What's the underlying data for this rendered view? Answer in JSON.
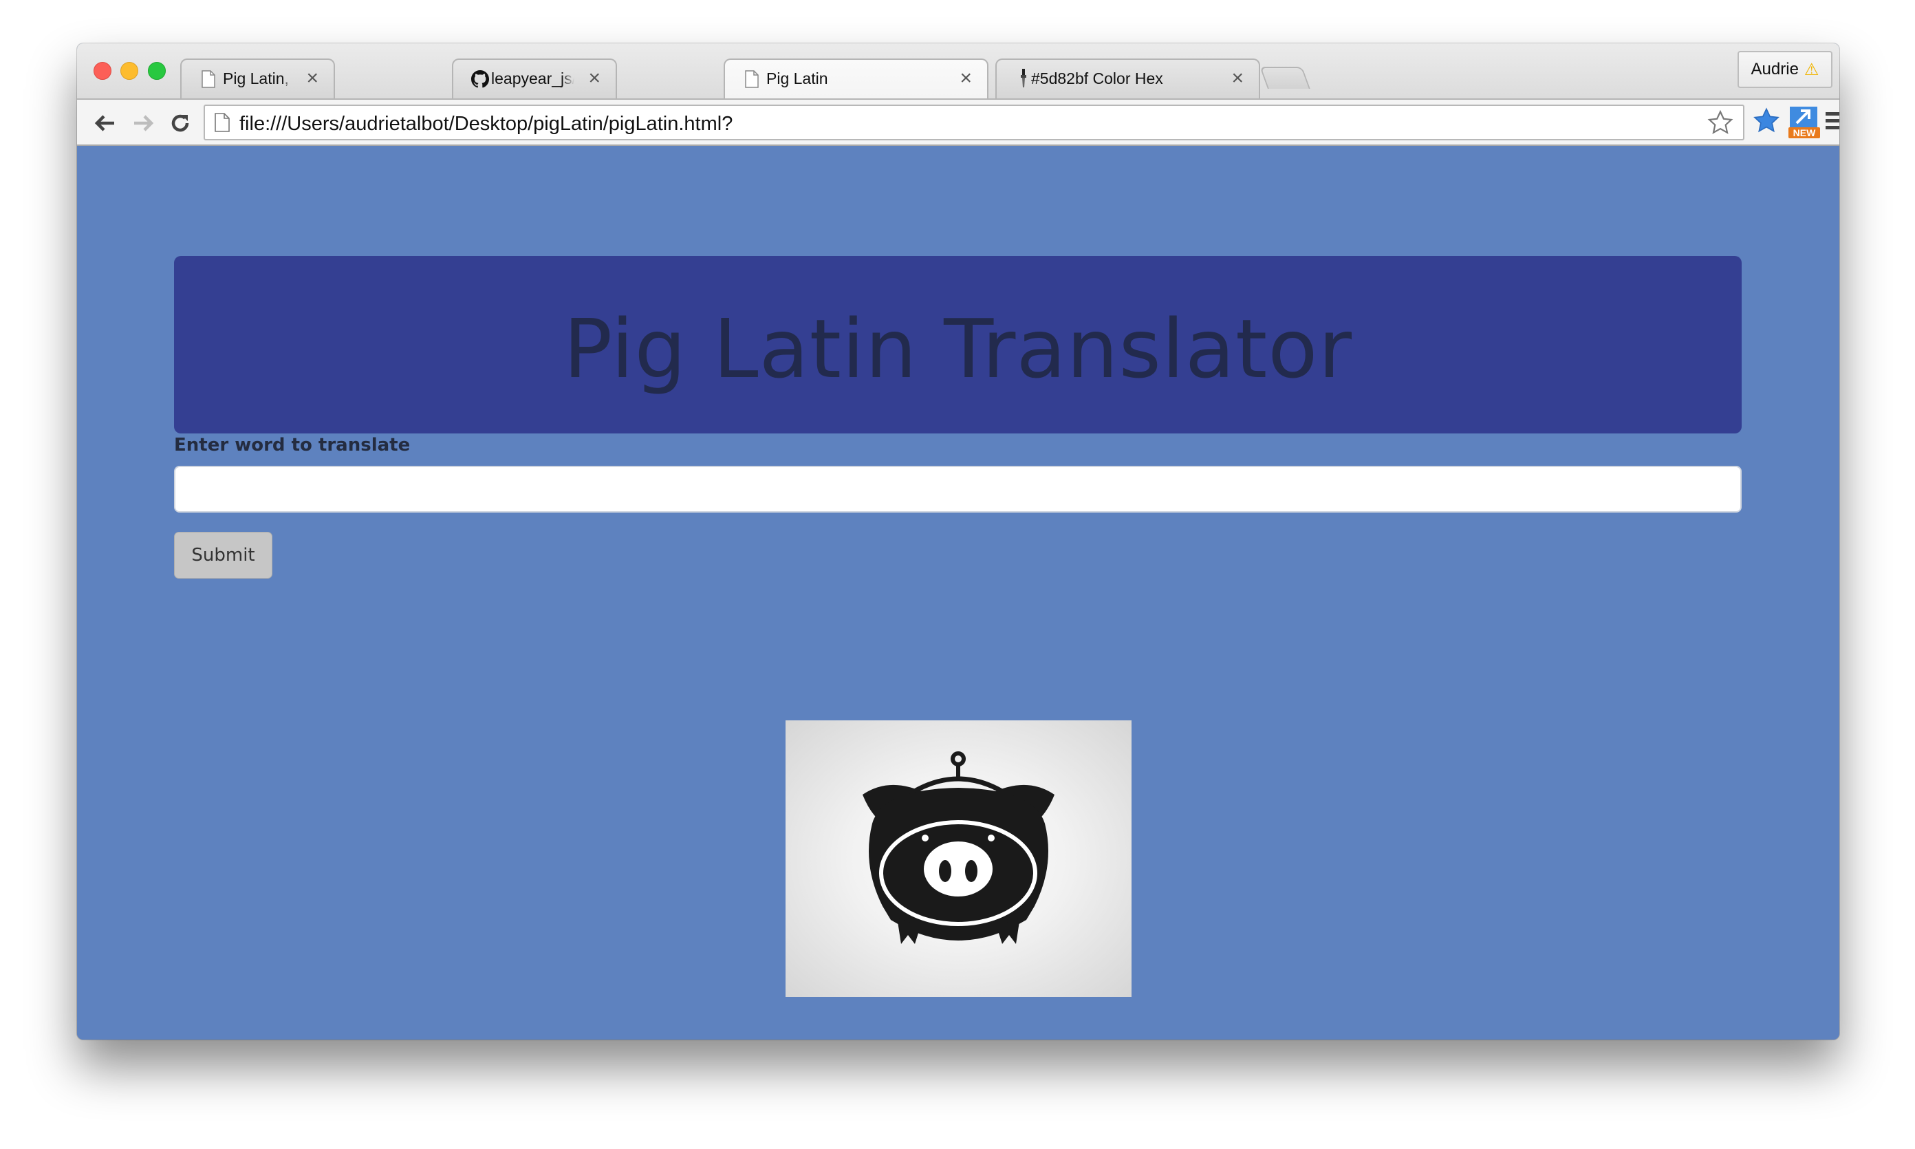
{
  "browser": {
    "tabs": [
      {
        "title": "Pig Latin, Palindromes, Pri",
        "icon": "page-icon",
        "active": false
      },
      {
        "title": "leapyear_js/styles.css at m",
        "icon": "github-icon",
        "active": false
      },
      {
        "title": "Pig Latin",
        "icon": "page-icon",
        "active": true
      },
      {
        "title": "#5d82bf Color Hex",
        "icon": "color-dropper-icon",
        "active": false
      }
    ],
    "close_symbol": "×",
    "profile_name": "Audrie",
    "profile_warning": "⚠",
    "url": "file:///Users/audrietalbot/Desktop/pigLatin/pigLatin.html?",
    "extension_badge": "NEW"
  },
  "page": {
    "heading": "Pig Latin Translator",
    "input_label": "Enter word to translate",
    "input_value": "",
    "submit_label": "Submit",
    "image_icon": "pig-icon"
  },
  "colors": {
    "page_background": "#5e82bf",
    "jumbotron": "#343f92",
    "heading_text": "#222a4d"
  }
}
